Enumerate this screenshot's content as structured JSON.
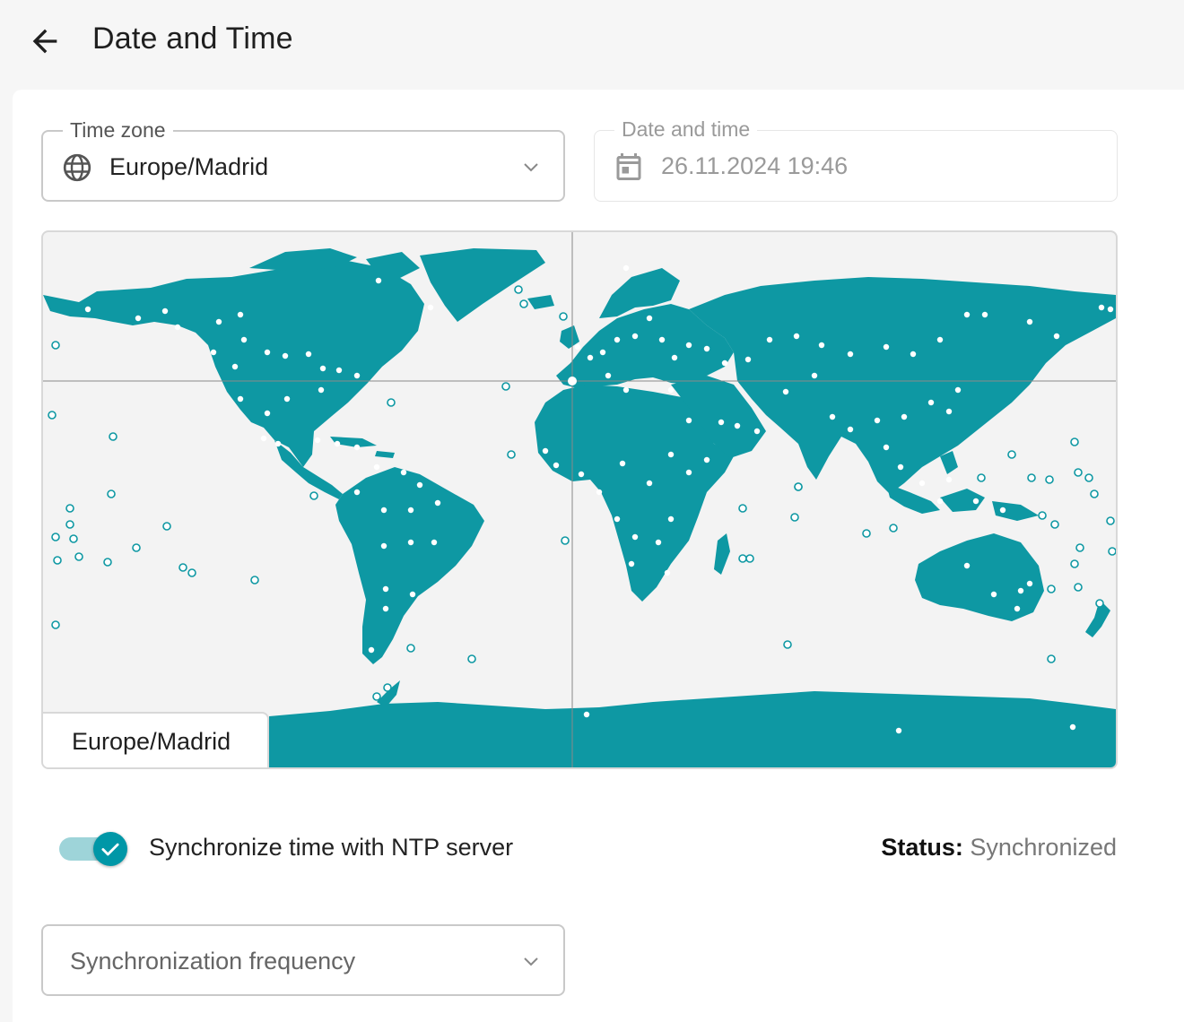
{
  "header": {
    "title": "Date and Time"
  },
  "timezone_field": {
    "label": "Time zone",
    "value": "Europe/Madrid"
  },
  "datetime_field": {
    "label": "Date and time",
    "value": "26.11.2024 19:46",
    "disabled": true
  },
  "map": {
    "selected_timezone": "Europe/Madrid"
  },
  "ntp": {
    "label": "Synchronize time with NTP server",
    "enabled": true,
    "status_label": "Status:",
    "status_value": "Synchronized"
  },
  "frequency_field": {
    "placeholder": "Synchronization frequency"
  },
  "colors": {
    "accent": "#0097a7",
    "land": "#0e98a3",
    "ocean": "#f3f3f3"
  },
  "icons": {
    "back": "arrow-left-icon",
    "timezone": "globe-icon",
    "datetime": "calendar-icon",
    "dropdown": "chevron-down-icon",
    "toggle": "check-icon"
  }
}
